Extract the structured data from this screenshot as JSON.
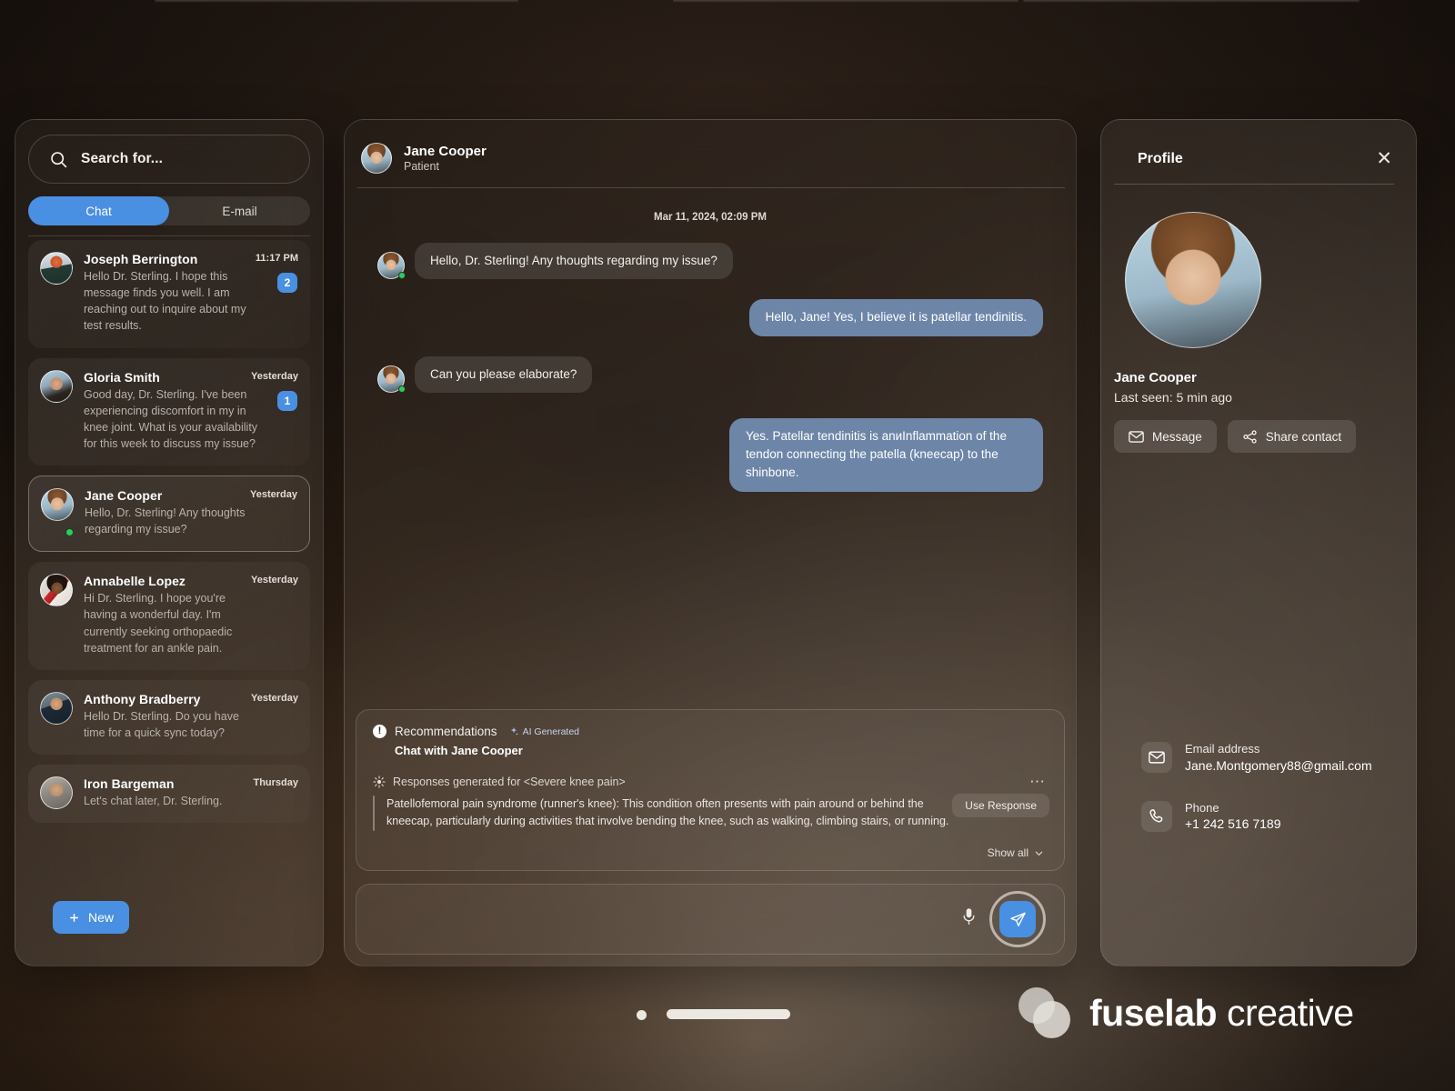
{
  "search": {
    "placeholder": "Search for...",
    "icon": "search-icon"
  },
  "tabs": [
    {
      "label": "Chat",
      "active": true
    },
    {
      "label": "E-mail",
      "active": false
    }
  ],
  "conversations": [
    {
      "name": "Joseph Berrington",
      "preview": "Hello Dr. Sterling. I hope this message finds you well. I am reaching out to inquire about my test results.",
      "time": "11:17 PM",
      "badge": "2",
      "online": false,
      "selected": false,
      "pic": "pic-joseph"
    },
    {
      "name": "Gloria Smith",
      "preview": "Good day, Dr. Sterling.  I've been experiencing discomfort in my in knee joint. What is your availability for this week to discuss my issue?",
      "time": "Yesterday",
      "badge": "1",
      "online": false,
      "selected": false,
      "pic": "pic-gloria"
    },
    {
      "name": "Jane Cooper",
      "preview": "Hello, Dr. Sterling!  Any thoughts regarding my issue?",
      "time": "Yesterday",
      "badge": "",
      "online": true,
      "selected": true,
      "pic": "pic-jane"
    },
    {
      "name": "Annabelle Lopez",
      "preview": "Hi Dr. Sterling. I hope you're having a wonderful day. I'm currently seeking orthopaedic treatment for an ankle pain.",
      "time": "Yesterday",
      "badge": "",
      "online": false,
      "selected": false,
      "pic": "pic-annabelle"
    },
    {
      "name": "Anthony Bradberry",
      "preview": "Hello Dr. Sterling. Do you have time for a quick sync today?",
      "time": "Yesterday",
      "badge": "",
      "online": false,
      "selected": false,
      "pic": "pic-anthony"
    },
    {
      "name": "Iron Bargeman",
      "preview": "Let's chat later, Dr. Sterling.",
      "time": "Thursday",
      "badge": "",
      "online": false,
      "selected": false,
      "pic": "pic-iron"
    }
  ],
  "new_button": {
    "label": "New",
    "icon": "plus-icon"
  },
  "chat": {
    "contact_name": "Jane Cooper",
    "contact_role": "Patient",
    "date_divider": "Mar 11, 2024, 02:09 PM",
    "messages": [
      {
        "dir": "in",
        "text": "Hello, Dr. Sterling!  Any thoughts regarding my issue?"
      },
      {
        "dir": "out",
        "text": "Hello, Jane! Yes, I believe it is patellar tendinitis."
      },
      {
        "dir": "in",
        "text": "Can you please elaborate?"
      },
      {
        "dir": "out",
        "text": "Yes.  Patellar tendinitis is anиInflammation of the tendon connecting the patella (kneecap) to the shinbone."
      }
    ]
  },
  "recommendations": {
    "title": "Recommendations",
    "ai_badge": "AI Generated",
    "subtitle": "Chat with Jane Cooper",
    "generated_for": "Responses generated for <Severe knee pain>",
    "response_text": "Patellofemoral pain syndrome (runner's knee): This condition often presents with pain around or behind the kneecap, particularly during activities that involve bending the knee, such as walking, climbing stairs, or running.",
    "use_response_label": "Use Response",
    "show_all_label": "Show all",
    "more_icon": "ellipsis-icon"
  },
  "composer": {
    "mic_icon": "microphone-icon",
    "send_icon": "send-paper-plane-icon"
  },
  "profile": {
    "title": "Profile",
    "close_icon": "close-icon",
    "name": "Jane Cooper",
    "last_seen": "Last seen: 5 min ago",
    "message_button": "Message",
    "share_button": "Share contact",
    "contacts": [
      {
        "icon": "envelope-icon",
        "label": "Email address",
        "value": "Jane.Montgomery88@gmail.com"
      },
      {
        "icon": "phone-icon",
        "label": "Phone",
        "value": "+1  242 516 7189"
      }
    ]
  },
  "brand": {
    "bold": "fuselab",
    "light": "creative"
  },
  "colors": {
    "accent": "#4a90e2",
    "out_bubble": "#6d86a8",
    "online": "#2ecc5a"
  }
}
